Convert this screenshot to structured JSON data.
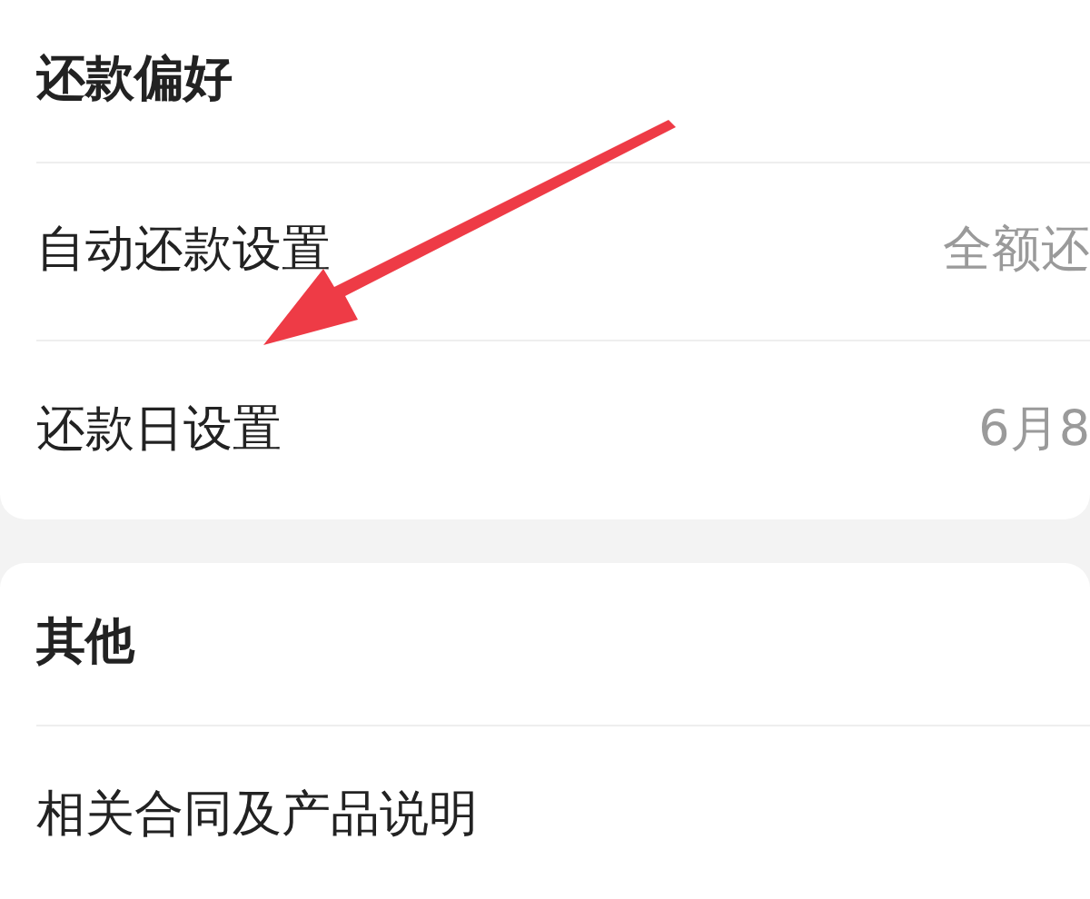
{
  "sections": [
    {
      "title": "还款偏好",
      "rows": [
        {
          "label": "自动还款设置",
          "value": "全额还"
        },
        {
          "label": "还款日设置",
          "value": "6月8"
        }
      ]
    },
    {
      "title": "其他",
      "rows": [
        {
          "label": "相关合同及产品说明"
        }
      ]
    }
  ]
}
